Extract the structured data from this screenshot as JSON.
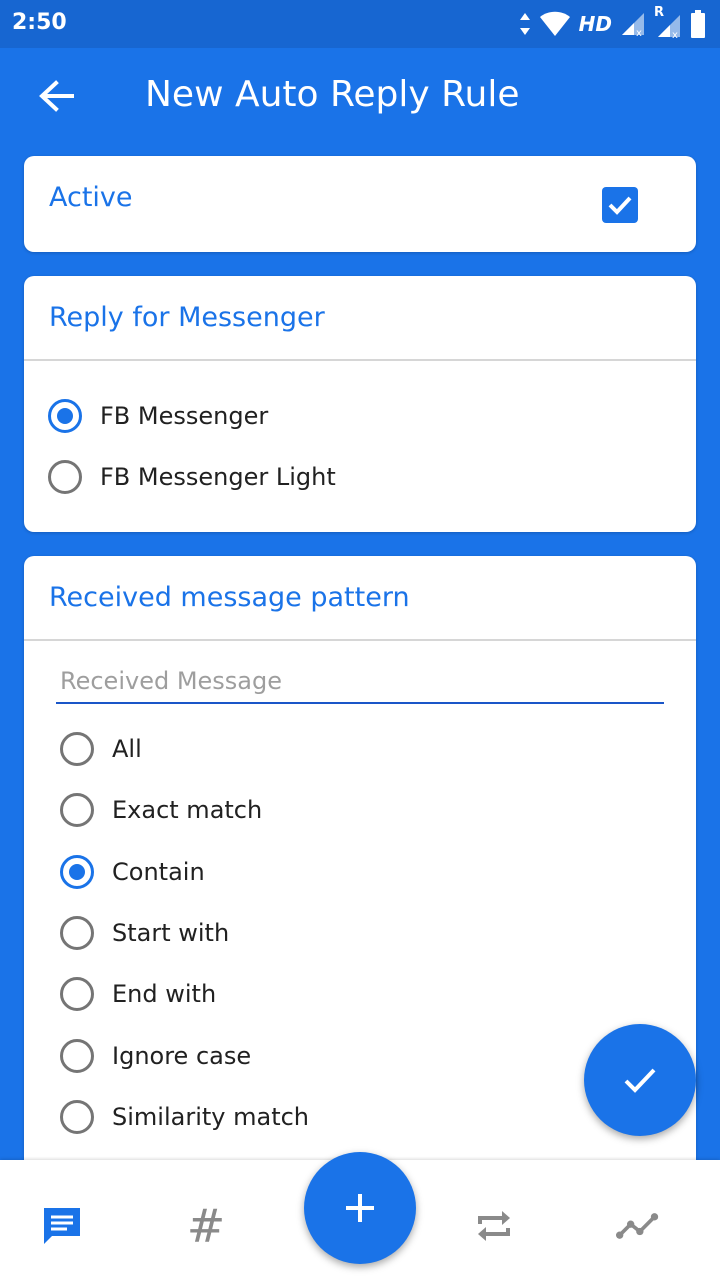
{
  "status_bar": {
    "time": "2:50",
    "network_label": "HD",
    "roaming_label": "R"
  },
  "app_bar": {
    "title": "New Auto Reply Rule",
    "back_icon": "arrow-left-icon"
  },
  "active_card": {
    "label": "Active",
    "checked": true
  },
  "messenger_card": {
    "title": "Reply for Messenger",
    "options": [
      {
        "label": "FB Messenger",
        "selected": true
      },
      {
        "label": "FB Messenger Light",
        "selected": false
      }
    ]
  },
  "pattern_card": {
    "title": "Received message pattern",
    "input": {
      "placeholder": "Received Message",
      "value": ""
    },
    "options": [
      {
        "label": "All",
        "selected": false
      },
      {
        "label": "Exact match",
        "selected": false
      },
      {
        "label": "Contain",
        "selected": true
      },
      {
        "label": "Start with",
        "selected": false
      },
      {
        "label": "End with",
        "selected": false
      },
      {
        "label": "Ignore case",
        "selected": false
      },
      {
        "label": "Similarity match",
        "selected": false
      }
    ]
  },
  "fab": {
    "confirm_icon": "check-icon",
    "add_icon": "plus-icon"
  },
  "bottom_nav": {
    "items": [
      {
        "icon": "message-icon",
        "active": true
      },
      {
        "icon": "hashtag-icon",
        "text": "#",
        "active": false
      },
      {
        "icon": "repeat-icon",
        "active": false
      },
      {
        "icon": "trend-icon",
        "active": false
      }
    ]
  },
  "colors": {
    "primary": "#1a73e8",
    "status_bar": "#1766d1",
    "inactive_icon": "#8a8a8a",
    "radio_unchecked": "#757575"
  }
}
